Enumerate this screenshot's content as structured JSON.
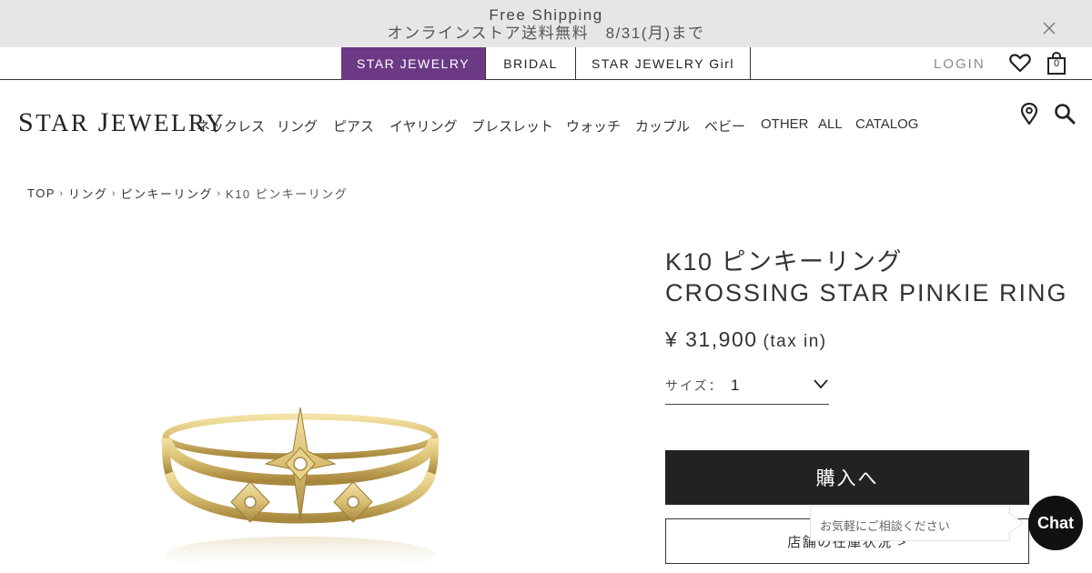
{
  "announcement": {
    "line1": "Free Shipping",
    "line2": "オンラインストア送料無料　8/31(月)まで",
    "close_icon": "close-icon"
  },
  "brand_tabs": [
    {
      "label": "STAR JEWELRY",
      "active": true
    },
    {
      "label": "BRIDAL",
      "active": false
    },
    {
      "label": "STAR JEWELRY Girl",
      "active": false
    }
  ],
  "account": {
    "login_label": "LOGIN",
    "cart_count": "0"
  },
  "header": {
    "logo_text": "STAR JEWELRY",
    "nav": [
      "ネックレス",
      "リング",
      "ピアス",
      "イヤリング",
      "ブレスレット",
      "ウォッチ",
      "カップル",
      "ベビー",
      "OTHER",
      "ALL",
      "CATALOG"
    ]
  },
  "breadcrumb": [
    "TOP",
    "リング",
    "ピンキーリング",
    "K10 ピンキーリング"
  ],
  "product": {
    "title_jp": "K10 ピンキーリング",
    "title_en": "CROSSING STAR PINKIE RING",
    "price": "¥ 31,900",
    "tax_note": "(tax in)",
    "size_label": "サイズ：",
    "size_value": "1",
    "buy_label": "購入へ",
    "stock_label": "店舗の在庫状況 >"
  },
  "chat": {
    "bubble_text": "お気軽にご相談ください",
    "button_label": "Chat"
  },
  "colors": {
    "accent_purple": "#6c3a85",
    "announce_bg": "#e6e6e6",
    "buy_button": "#222222",
    "gold": "#d9bf72"
  }
}
